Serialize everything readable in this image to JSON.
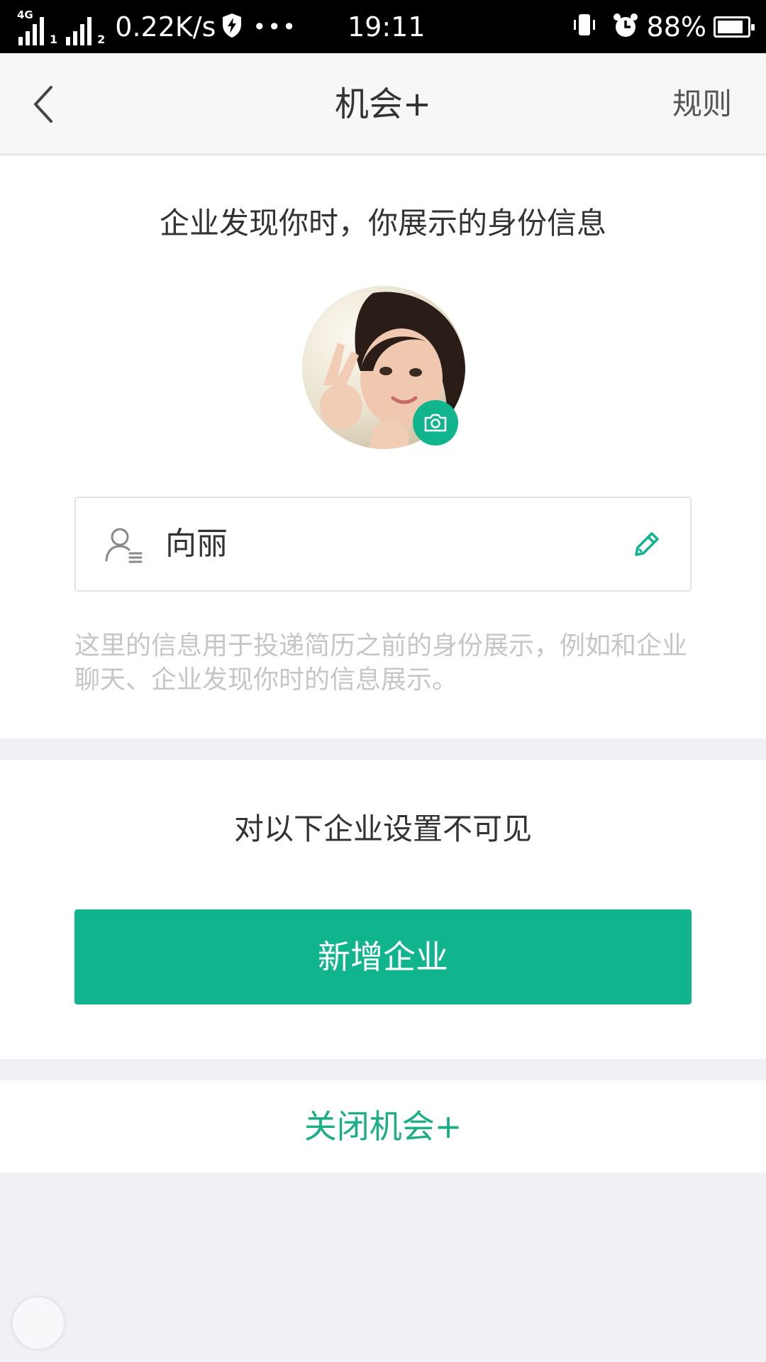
{
  "status_bar": {
    "network_type": "4G",
    "sim1": "1",
    "sim2": "2",
    "net_speed": "0.22K/s",
    "more": "•••",
    "time": "19:11",
    "battery": "88%",
    "battery_level": 0.88
  },
  "nav": {
    "title": "机会+",
    "rules": "规则"
  },
  "identity": {
    "title": "企业发现你时，你展示的身份信息",
    "name": "向丽",
    "hint": "这里的信息用于投递简历之前的身份展示，例如和企业聊天、企业发现你时的信息展示。"
  },
  "invisible": {
    "title": "对以下企业设置不可见",
    "add_button": "新增企业"
  },
  "close": {
    "label": "关闭机会+"
  },
  "colors": {
    "accent": "#10b58e",
    "close_text": "#1aad86",
    "hint_text": "#c6c6c6",
    "page_bg": "#f0f1f5"
  },
  "icons": {
    "back": "chevron-left-icon",
    "camera": "camera-icon",
    "user": "user-card-icon",
    "edit": "pencil-icon",
    "shield": "shield-bolt-icon",
    "vibrate": "vibrate-icon",
    "alarm": "alarm-clock-icon",
    "battery": "battery-icon"
  }
}
